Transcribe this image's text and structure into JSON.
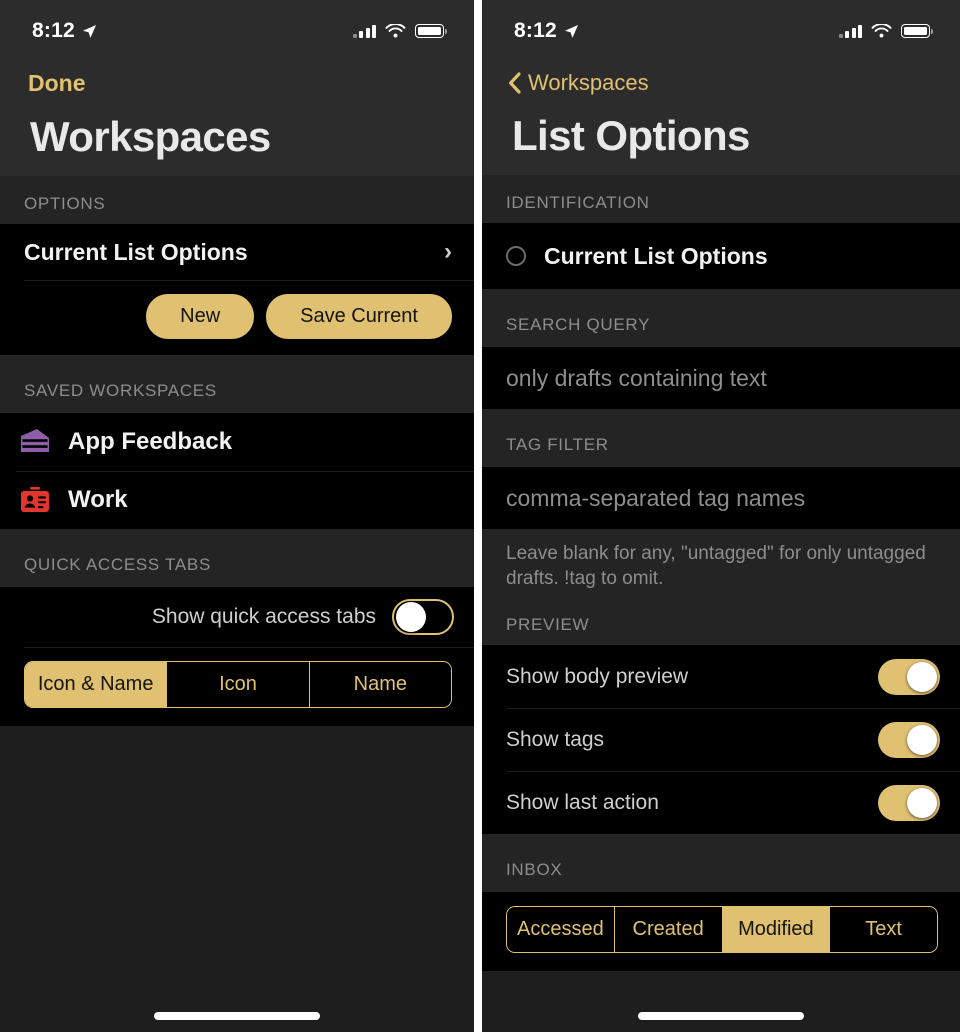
{
  "status_bar": {
    "time": "8:12",
    "location_icon": "location-arrow-icon",
    "signal_icon": "cellular-bars-icon",
    "wifi_icon": "wifi-icon",
    "battery_icon": "battery-full-icon"
  },
  "accent_color": "#e0c071",
  "left_screen": {
    "nav": {
      "done_label": "Done",
      "title": "Workspaces"
    },
    "options_section": {
      "header": "OPTIONS",
      "row_label": "Current List Options",
      "disclosure_icon": "chevron-right-icon",
      "buttons": [
        {
          "label": "New"
        },
        {
          "label": "Save Current"
        }
      ]
    },
    "saved_section": {
      "header": "SAVED WORKSPACES",
      "items": [
        {
          "label": "App Feedback",
          "icon": "cake-slice-icon",
          "icon_color": "#8e5fa8"
        },
        {
          "label": "Work",
          "icon": "id-card-icon",
          "icon_color": "#e1352e"
        }
      ]
    },
    "quick_access_section": {
      "header": "QUICK ACCESS TABS",
      "toggle_label": "Show quick access tabs",
      "toggle_on": false,
      "segment_options": [
        "Icon & Name",
        "Icon",
        "Name"
      ],
      "segment_selected": "Icon & Name"
    }
  },
  "right_screen": {
    "nav": {
      "back_label": "Workspaces",
      "back_icon": "chevron-left-icon",
      "title": "List Options"
    },
    "identification_section": {
      "header": "IDENTIFICATION",
      "row_label": "Current List Options",
      "radio_icon": "circle-icon"
    },
    "search_query_section": {
      "header": "SEARCH QUERY",
      "placeholder": "only drafts containing text",
      "value": ""
    },
    "tag_filter_section": {
      "header": "TAG FILTER",
      "placeholder": "comma-separated tag names",
      "value": "",
      "helper": "Leave blank for any, \"untagged\" for only untagged drafts. !tag to omit."
    },
    "preview_section": {
      "header": "PREVIEW",
      "toggles": [
        {
          "label": "Show body preview",
          "on": true
        },
        {
          "label": "Show tags",
          "on": true
        },
        {
          "label": "Show last action",
          "on": true
        }
      ]
    },
    "inbox_section": {
      "header": "INBOX",
      "segment_options": [
        "Accessed",
        "Created",
        "Modified",
        "Text"
      ],
      "segment_selected": "Modified"
    }
  }
}
